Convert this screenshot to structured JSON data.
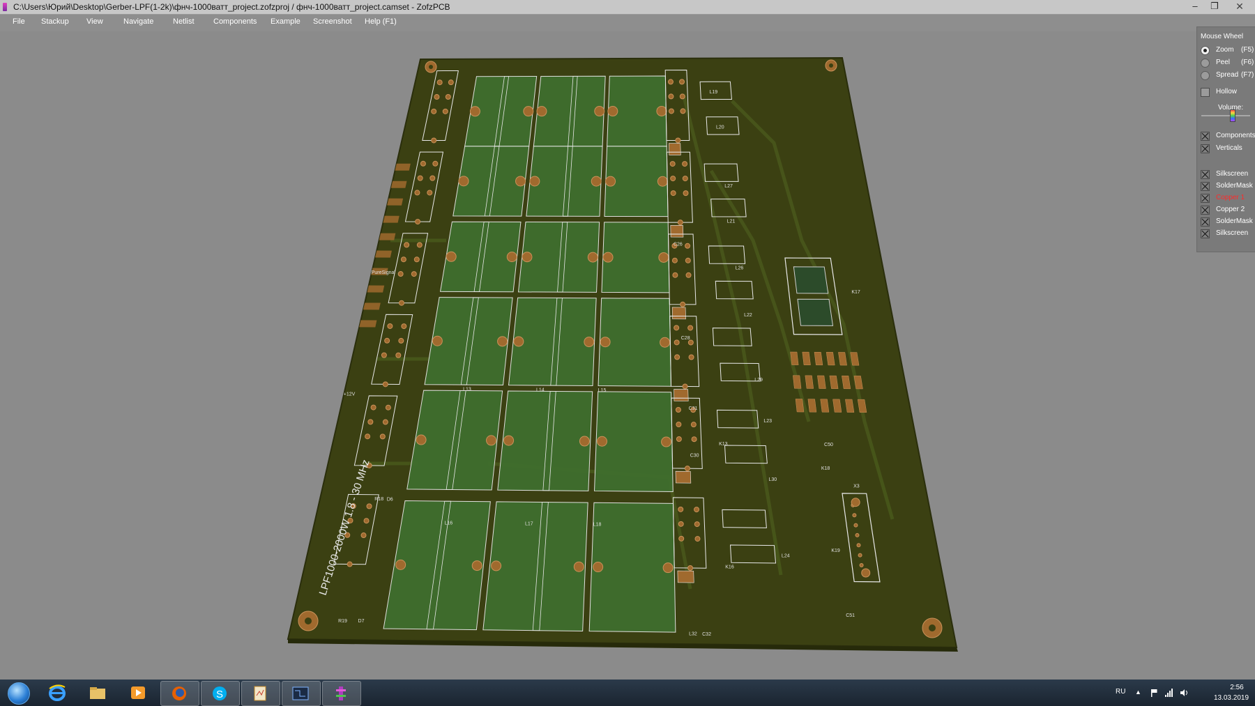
{
  "window": {
    "title": "C:\\Users\\Юрий\\Desktop\\Gerber-LPF(1-2k)\\фнч-1000ватт_project.zofzproj / фнч-1000ватт_project.camset - ZofzPCB",
    "controls": {
      "minimize": "‒",
      "maximize": "❐",
      "close": "✕"
    }
  },
  "menu": {
    "file": "File",
    "stackup": "Stackup",
    "view": "View",
    "navigate": "Navigate",
    "netlist": "Netlist",
    "components": "Components",
    "example": "Example",
    "screenshot": "Screenshot",
    "help": "Help (F1)"
  },
  "board": {
    "silkscreen_text": "LPF1000-2000W 1.8 - 30 MHz",
    "labels": [
      "L32",
      "C32",
      "L24",
      "L30",
      "L23",
      "L29",
      "L22",
      "L26",
      "L21",
      "L27",
      "L20",
      "L19",
      "C28",
      "C26",
      "C30",
      "C31",
      "X3",
      "K19",
      "K18",
      "C51",
      "C50",
      "R19",
      "D7",
      "R18",
      "D6",
      "K17",
      "K16",
      "K13",
      "L18",
      "L17",
      "L16",
      "L15",
      "L14",
      "L13",
      "PureSignal",
      "+12V"
    ]
  },
  "panel": {
    "header": "Mouse Wheel",
    "radios": [
      {
        "label": "Zoom",
        "key": "(F5)",
        "selected": true
      },
      {
        "label": "Peel",
        "key": "(F6)",
        "selected": false
      },
      {
        "label": "Spread",
        "key": "(F7)",
        "selected": false
      }
    ],
    "hollow": {
      "label": "Hollow",
      "checked": false
    },
    "volume_label": "Volume:",
    "volume_level": 0.68,
    "toggles": [
      {
        "label": "Components",
        "checked": true
      },
      {
        "label": "Verticals",
        "checked": true
      }
    ],
    "layers": [
      {
        "label": "Silkscreen",
        "checked": true,
        "color": "#ffffff"
      },
      {
        "label": "SolderMask",
        "checked": true,
        "color": "#ffffff"
      },
      {
        "label": "Copper 1",
        "checked": true,
        "color": "#ff2a2a"
      },
      {
        "label": "Copper 2",
        "checked": true,
        "color": "#ffffff"
      },
      {
        "label": "SolderMask",
        "checked": true,
        "color": "#ffffff"
      },
      {
        "label": "Silkscreen",
        "checked": true,
        "color": "#ffffff"
      }
    ]
  },
  "taskbar": {
    "apps": [
      "start-orb",
      "internet-explorer",
      "file-explorer",
      "media-player",
      "firefox",
      "skype",
      "document-viewer",
      "pcb-editor",
      "zofzpcb"
    ],
    "language": "RU",
    "time": "2:56",
    "date": "13.03.2019"
  },
  "colors": {
    "board": "#3b4012",
    "copper": "#a06a2e",
    "mask_pad": "#3f6e2e",
    "silkscreen": "#e8e8e8",
    "background": "#8b8b8b"
  }
}
